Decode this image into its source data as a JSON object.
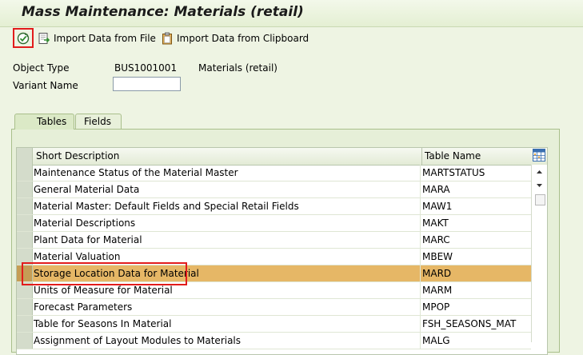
{
  "window": {
    "title": "Mass Maintenance: Materials (retail)"
  },
  "toolbar": {
    "import_file_label": "Import Data from File",
    "import_clipboard_label": "Import Data from Clipboard"
  },
  "form": {
    "object_type_label": "Object Type",
    "object_type_value": "BUS1001001",
    "object_type_desc": "Materials (retail)",
    "variant_name_label": "Variant Name",
    "variant_name_value": ""
  },
  "tabs": [
    {
      "label": "Tables",
      "active": true
    },
    {
      "label": "Fields",
      "active": false
    }
  ],
  "table": {
    "columns": [
      "Short Description",
      "Table Name"
    ],
    "rows": [
      {
        "desc": "Maintenance Status of the Material Master",
        "name": "MARTSTATUS"
      },
      {
        "desc": "General Material Data",
        "name": "MARA"
      },
      {
        "desc": "Material Master: Default Fields and Special Retail Fields",
        "name": "MAW1"
      },
      {
        "desc": "Material Descriptions",
        "name": "MAKT"
      },
      {
        "desc": "Plant Data for Material",
        "name": "MARC"
      },
      {
        "desc": "Material Valuation",
        "name": "MBEW"
      },
      {
        "desc": "Storage Location Data for Material",
        "name": "MARD"
      },
      {
        "desc": "Units of Measure for Material",
        "name": "MARM"
      },
      {
        "desc": "Forecast Parameters",
        "name": "MPOP"
      },
      {
        "desc": "Table for Seasons In Material",
        "name": "FSH_SEASONS_MAT"
      },
      {
        "desc": "Assignment of Layout Modules to Materials",
        "name": "MALG"
      }
    ],
    "selected_row": "Storage Location Data for Material"
  },
  "icons": {
    "execute": "execute-icon",
    "import_file": "import-file-icon",
    "import_clipboard": "clipboard-icon",
    "table_settings": "table-settings-icon",
    "scroll_up": "scroll-up-icon",
    "scroll_down": "scroll-down-icon"
  },
  "colors": {
    "background": "#eef4e3",
    "selected_row": "#e6b766",
    "highlight_border": "#e21c1c"
  }
}
